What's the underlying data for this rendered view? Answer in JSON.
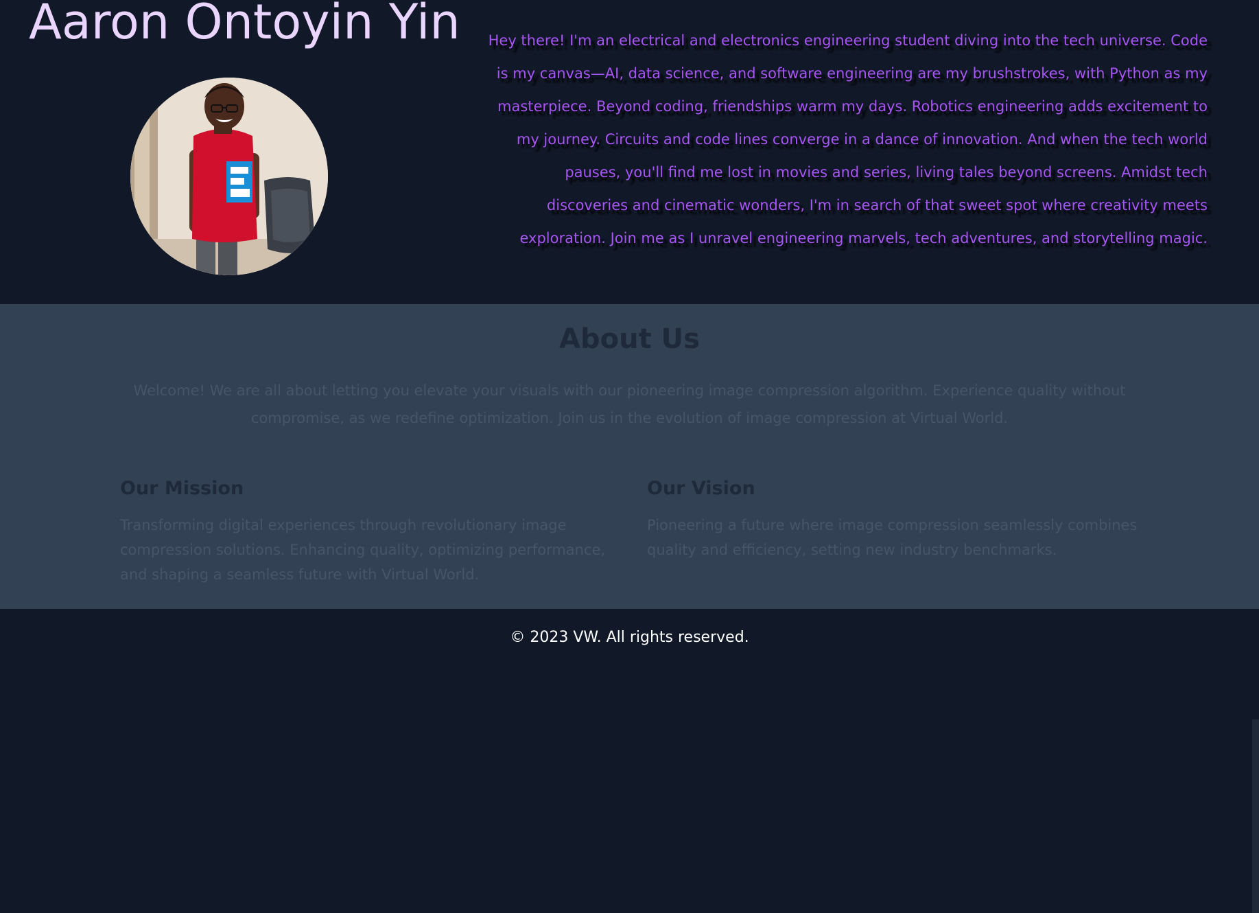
{
  "hero": {
    "name": "Aaron Ontoyin Yin",
    "bio": "Hey there! I'm an electrical and electronics engineering student diving into the tech universe. Code is my canvas—AI, data science, and software engineering are my brushstrokes, with Python as my masterpiece. Beyond coding, friendships warm my days. Robotics engineering adds excitement to my journey. Circuits and code lines converge in a dance of innovation. And when the tech world pauses, you'll find me lost in movies and series, living tales beyond screens. Amidst tech discoveries and cinematic wonders, I'm in search of that sweet spot where creativity meets exploration. Join me as I unravel engineering marvels, tech adventures, and storytelling magic."
  },
  "about": {
    "title": "About Us",
    "text": "Welcome! We are all about letting you elevate your visuals with our pioneering image compression algorithm. Experience quality without compromise, as we redefine optimization. Join us in the evolution of image compression at Virtual World.",
    "mission": {
      "heading": "Our Mission",
      "text": "Transforming digital experiences through revolutionary image compression solutions. Enhancing quality, optimizing performance, and shaping a seamless future with Virtual World."
    },
    "vision": {
      "heading": "Our Vision",
      "text": "Pioneering a future where image compression seamlessly combines quality and efficiency, setting new industry benchmarks."
    }
  },
  "footer": {
    "text": "© 2023 VW. All rights reserved."
  },
  "colors": {
    "background": "#111827",
    "name": "#e9d5ff",
    "bio": "#a855f7",
    "section": "#334155",
    "footer_text": "#ffffff"
  }
}
